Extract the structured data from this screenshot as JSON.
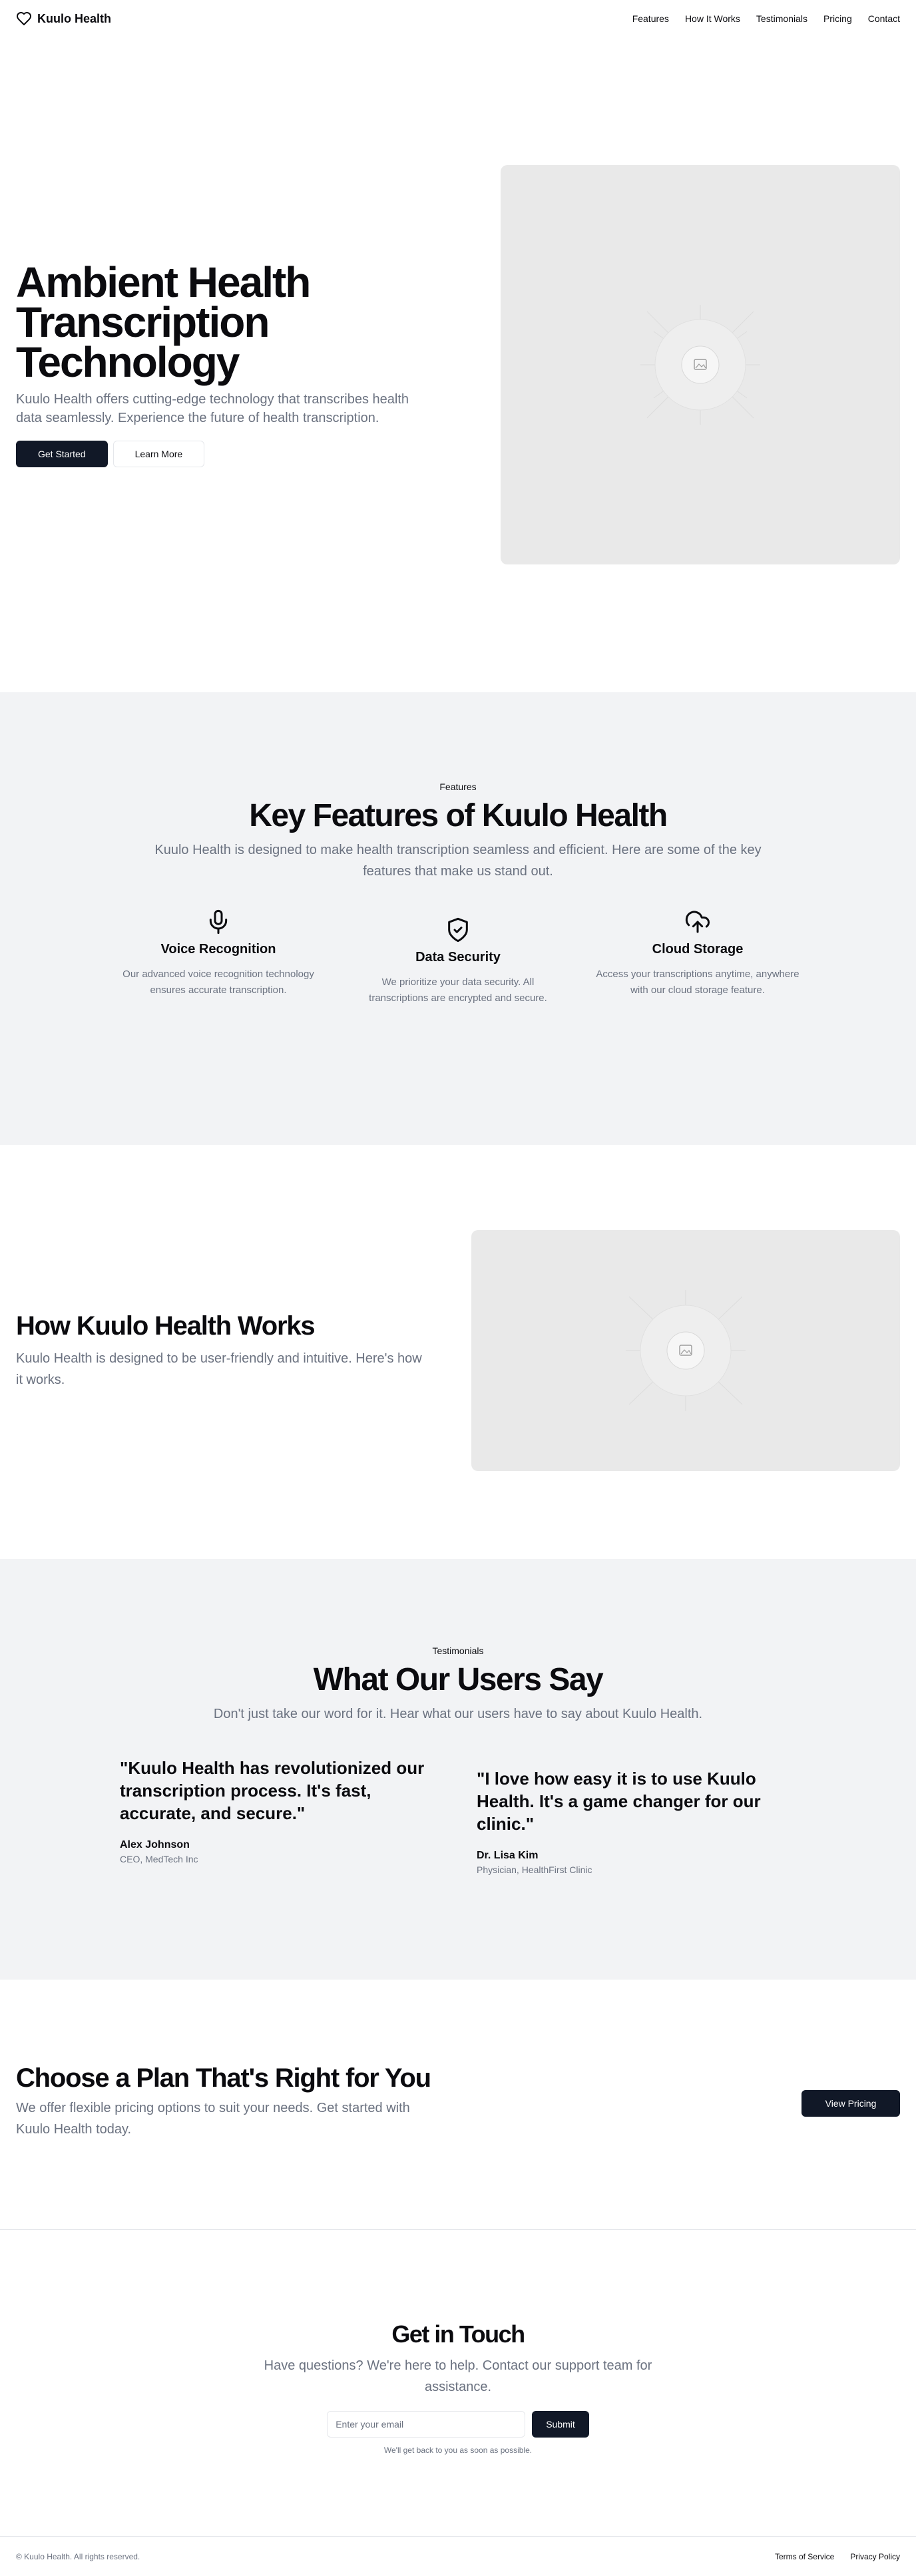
{
  "brand": {
    "name": "Kuulo Health",
    "icon": "heart-icon"
  },
  "nav": [
    "Features",
    "How It Works",
    "Testimonials",
    "Pricing",
    "Contact"
  ],
  "hero": {
    "title": "Ambient Health Transcription Technology",
    "subtitle": "Kuulo Health offers cutting-edge technology that transcribes health data seamlessly. Experience the future of health transcription.",
    "primary_button": "Get Started",
    "secondary_button": "Learn More",
    "image_icon": "image-placeholder-icon"
  },
  "features": {
    "eyebrow": "Features",
    "title": "Key Features of Kuulo Health",
    "subtitle": "Kuulo Health is designed to make health transcription seamless and efficient. Here are some of the key features that make us stand out.",
    "items": [
      {
        "icon": "microphone-icon",
        "title": "Voice Recognition",
        "description": "Our advanced voice recognition technology ensures accurate transcription."
      },
      {
        "icon": "shield-check-icon",
        "title": "Data Security",
        "description": "We prioritize your data security. All transcriptions are encrypted and secure."
      },
      {
        "icon": "cloud-upload-icon",
        "title": "Cloud Storage",
        "description": "Access your transcriptions anytime, anywhere with our cloud storage feature."
      }
    ]
  },
  "how": {
    "title": "How Kuulo Health Works",
    "subtitle": "Kuulo Health is designed to be user-friendly and intuitive. Here's how it works."
  },
  "testimonials": {
    "eyebrow": "Testimonials",
    "title": "What Our Users Say",
    "subtitle": "Don't just take our word for it. Hear what our users have to say about Kuulo Health.",
    "items": [
      {
        "quote": "\"Kuulo Health has revolutionized our transcription process. It's fast, accurate, and secure.\"",
        "name": "Alex Johnson",
        "role": "CEO, MedTech Inc"
      },
      {
        "quote": "\"I love how easy it is to use Kuulo Health. It's a game changer for our clinic.\"",
        "name": "Dr. Lisa Kim",
        "role": "Physician, HealthFirst Clinic"
      }
    ]
  },
  "pricing": {
    "title": "Choose a Plan That's Right for You",
    "subtitle": "We offer flexible pricing options to suit your needs. Get started with Kuulo Health today.",
    "button": "View Pricing"
  },
  "contact": {
    "title": "Get in Touch",
    "subtitle": "Have questions? We're here to help. Contact our support team for assistance.",
    "email_placeholder": "Enter your email",
    "submit": "Submit",
    "note": "We'll get back to you as soon as possible."
  },
  "footer": {
    "copyright": "© Kuulo Health. All rights reserved.",
    "links": [
      "Terms of Service",
      "Privacy Policy"
    ]
  },
  "colors": {
    "primary": "#111827",
    "muted": "#6b7280",
    "section_bg": "#f2f3f5",
    "placeholder_bg": "#e9e9e9"
  }
}
